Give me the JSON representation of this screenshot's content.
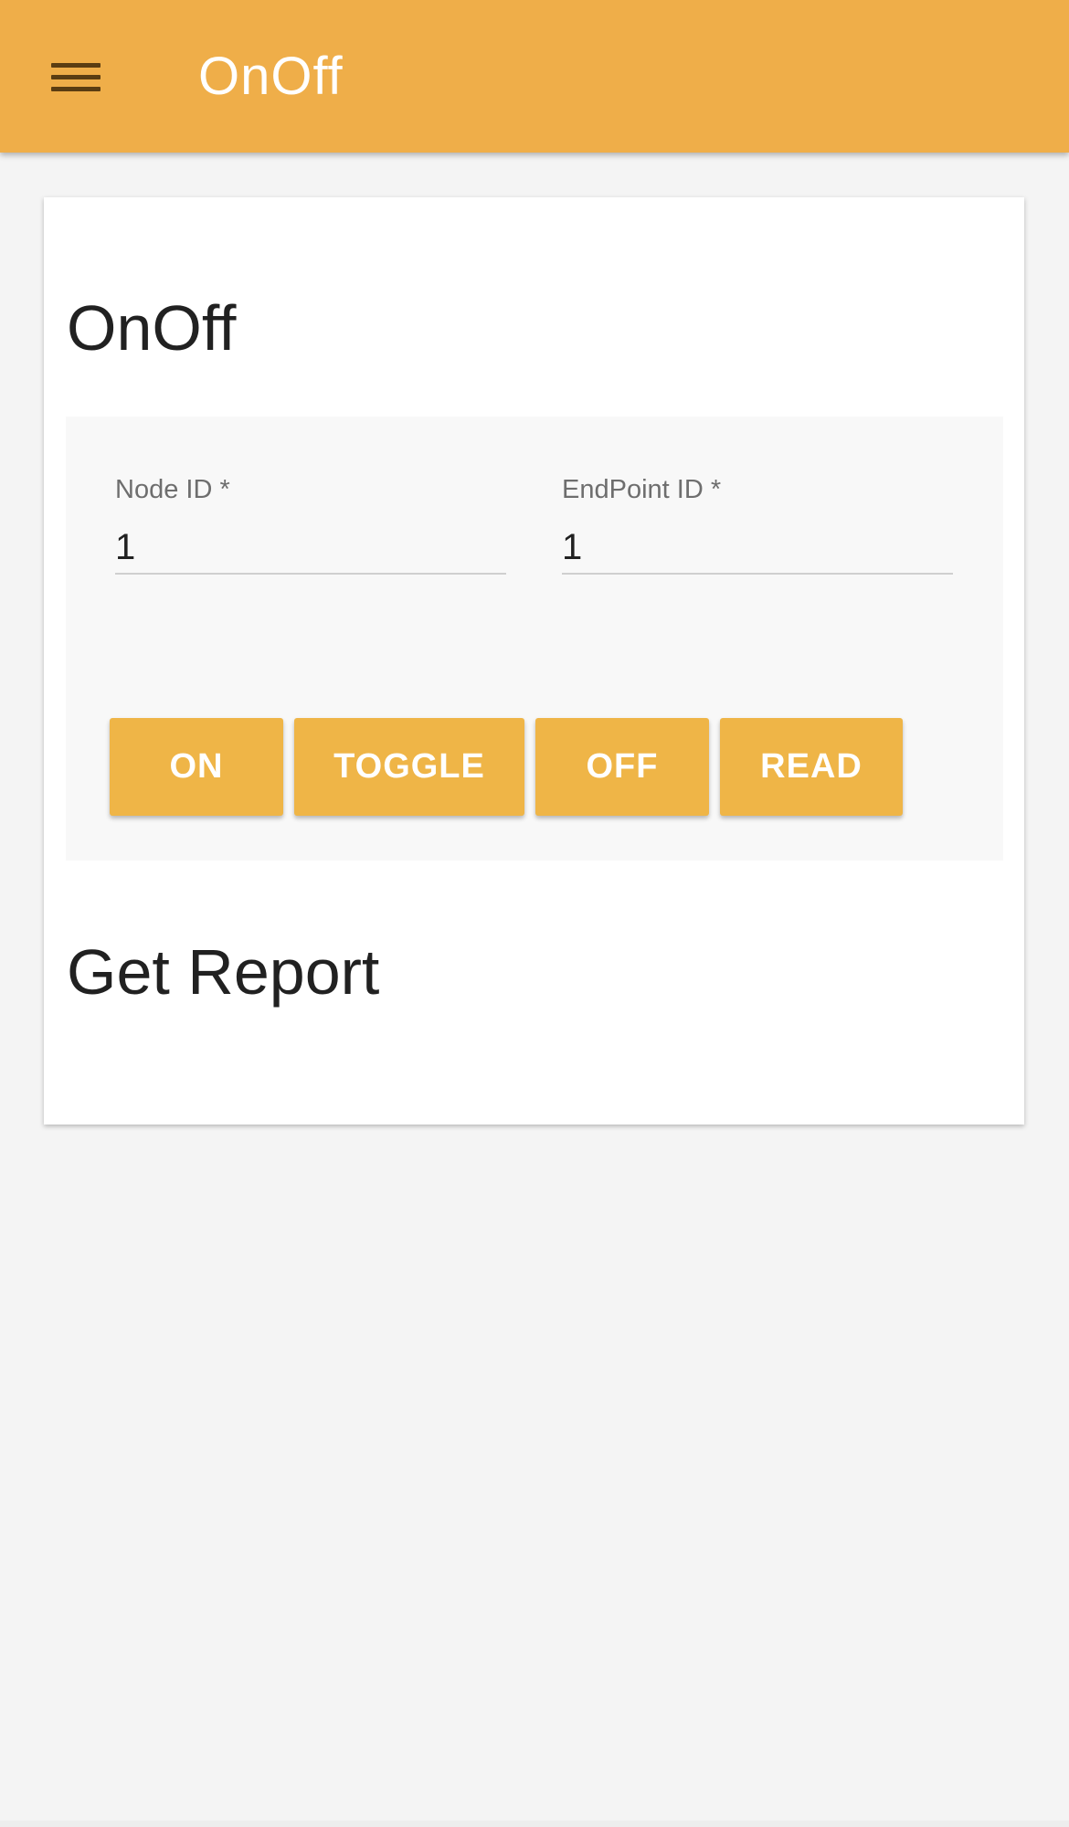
{
  "app_bar": {
    "title": "OnOff",
    "menu_icon": "hamburger-menu-icon",
    "color": "#efae49"
  },
  "card": {
    "title": "OnOff",
    "fields": {
      "node_id": {
        "label": "Node ID *",
        "value": "1"
      },
      "endpoint_id": {
        "label": "EndPoint ID *",
        "value": "1"
      }
    },
    "buttons": {
      "on": "ON",
      "toggle": "TOGGLE",
      "off": "OFF",
      "read": "READ"
    },
    "button_color": "#efb547",
    "report_title": "Get Report"
  }
}
